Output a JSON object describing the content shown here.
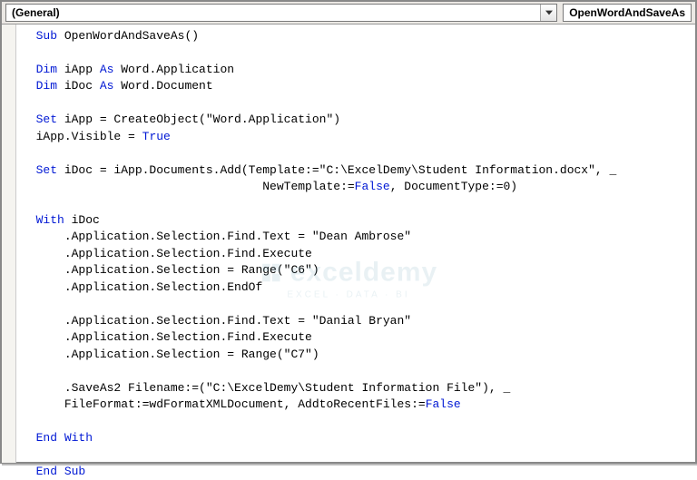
{
  "header": {
    "scope": "(General)",
    "procedure": "OpenWordAndSaveAs"
  },
  "code": {
    "l1a": "Sub",
    "l1b": " OpenWordAndSaveAs()",
    "l3a": "Dim",
    "l3b": " iApp ",
    "l3c": "As",
    "l3d": " Word.Application",
    "l4a": "Dim",
    "l4b": " iDoc ",
    "l4c": "As",
    "l4d": " Word.Document",
    "l6a": "Set",
    "l6b": " iApp = CreateObject(\"Word.Application\")",
    "l7a": "iApp.Visible = ",
    "l7b": "True",
    "l9a": "Set",
    "l9b": " iDoc = iApp.Documents.Add(Template:=\"C:\\ExcelDemy\\Student Information.docx\", _",
    "l10a": "                                NewTemplate:=",
    "l10b": "False",
    "l10c": ", DocumentType:=0)",
    "l12a": "With",
    "l12b": " iDoc",
    "l13": "    .Application.Selection.Find.Text = \"Dean Ambrose\"",
    "l14": "    .Application.Selection.Find.Execute",
    "l15": "    .Application.Selection = Range(\"C6\")",
    "l16": "    .Application.Selection.EndOf",
    "l18": "    .Application.Selection.Find.Text = \"Danial Bryan\"",
    "l19": "    .Application.Selection.Find.Execute",
    "l20": "    .Application.Selection = Range(\"C7\")",
    "l22": "    .SaveAs2 Filename:=(\"C:\\ExcelDemy\\Student Information File\"), _",
    "l23a": "    FileFormat:=wdFormatXMLDocument, AddtoRecentFiles:=",
    "l23b": "False",
    "l25": "End With",
    "l27": "End Sub"
  },
  "watermark": {
    "brand": "exceldemy",
    "tag": "EXCEL · DATA · BI"
  }
}
